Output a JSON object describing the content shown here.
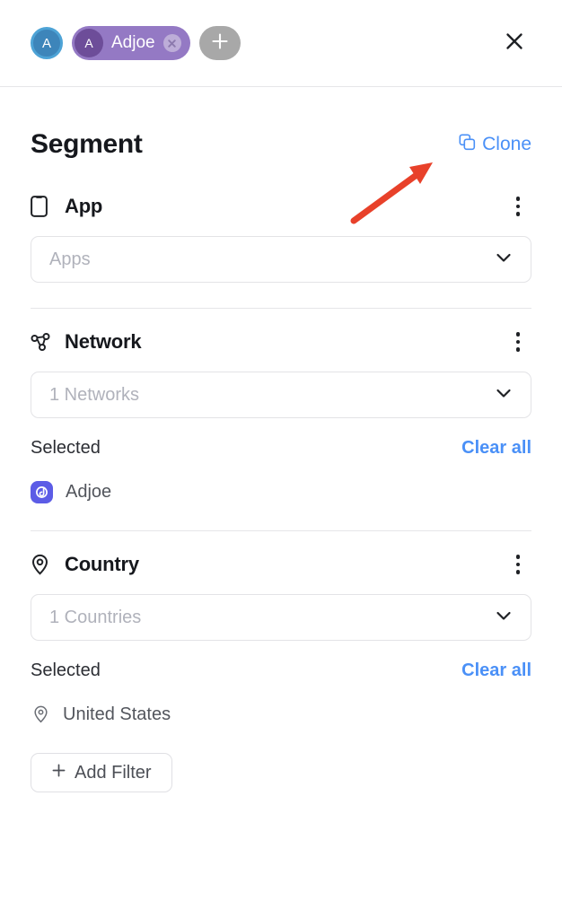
{
  "topbar": {
    "workspace_avatar_initial": "A",
    "active_chip": {
      "avatar_initial": "A",
      "label": "Adjoe",
      "close_icon": "chip-close-icon"
    },
    "add_chip_icon": "plus-icon",
    "close_icon": "close-icon",
    "colors": {
      "workspace_avatar": "#3d85ba",
      "workspace_avatar_ring": "#4da3d6",
      "chip_bg": "#9479c4",
      "chip_avatar_bg": "#6d4d99",
      "add_chip_bg": "#a8a8a8"
    }
  },
  "segment": {
    "title": "Segment",
    "clone_label": "Clone",
    "clone_icon": "copy-icon",
    "accent_color": "#4a90f7"
  },
  "sections": [
    {
      "id": "app",
      "icon": "mobile-phone-icon",
      "title": "App",
      "menu_icon": "kebab-menu-icon",
      "select_placeholder": "Apps",
      "chevron_icon": "chevron-down-icon",
      "has_selected": false
    },
    {
      "id": "network",
      "icon": "network-nodes-icon",
      "title": "Network",
      "menu_icon": "kebab-menu-icon",
      "select_placeholder": "1 Networks",
      "chevron_icon": "chevron-down-icon",
      "has_selected": true,
      "selected_label": "Selected",
      "clear_all_label": "Clear all",
      "selected_items": [
        {
          "name": "Adjoe",
          "icon": "adjoe-logo-icon",
          "icon_color": "#5c5ce6"
        }
      ]
    },
    {
      "id": "country",
      "icon": "map-pin-icon",
      "title": "Country",
      "menu_icon": "kebab-menu-icon",
      "select_placeholder": "1 Countries",
      "chevron_icon": "chevron-down-icon",
      "has_selected": true,
      "selected_label": "Selected",
      "clear_all_label": "Clear all",
      "selected_items": [
        {
          "name": "United States",
          "icon": "map-pin-icon",
          "icon_color": "#6b6e75"
        }
      ]
    }
  ],
  "add_filter": {
    "label": "Add Filter",
    "plus_icon": "plus-icon"
  },
  "annotation": {
    "type": "arrow",
    "color": "#e8412a",
    "points_to": "clone-link"
  }
}
